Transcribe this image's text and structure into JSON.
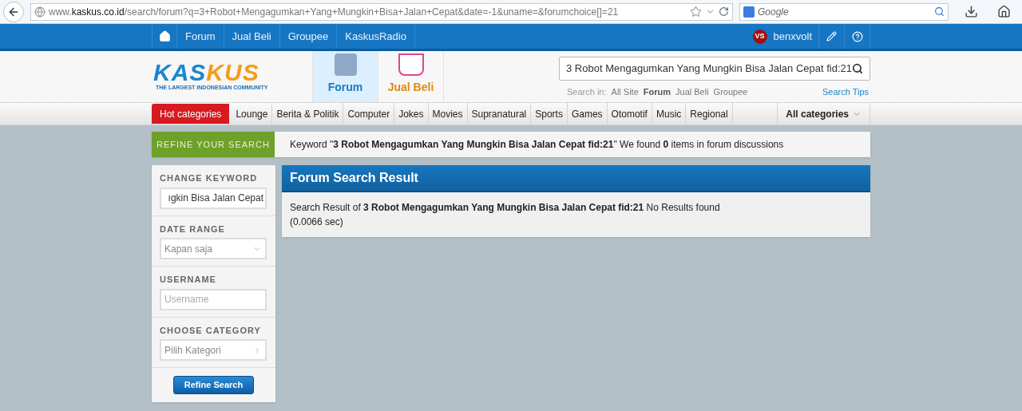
{
  "browser": {
    "url_prefix": "www.",
    "url_domain": "kaskus.co.id",
    "url_path": "/search/forum?q=3+Robot+Mengagumkan+Yang+Mungkin+Bisa+Jalan+Cepat&date=-1&uname=&forumchoice[]=21",
    "search_placeholder": "Google"
  },
  "top_nav": {
    "items": [
      "Forum",
      "Jual Beli",
      "Groupee",
      "KaskusRadio"
    ],
    "username": "benxvolt",
    "avatar_text": "VS"
  },
  "logo": {
    "part1": "KAS",
    "part2": "KUS",
    "tagline": "THE LARGEST INDONESIAN COMMUNITY"
  },
  "header_tabs": [
    {
      "label": "Forum",
      "selected": true
    },
    {
      "label": "Jual Beli",
      "selected": false
    }
  ],
  "search": {
    "value": "3 Robot Mengagumkan Yang Mungkin Bisa Jalan Cepat fid:21",
    "scope_label": "Search in:",
    "scopes": [
      {
        "label": "All Site",
        "selected": false
      },
      {
        "label": "Forum",
        "selected": true
      },
      {
        "label": "Jual Beli",
        "selected": false
      },
      {
        "label": "Groupee",
        "selected": false
      }
    ],
    "tips": "Search Tips"
  },
  "categories": {
    "hot": "Hot categories",
    "items": [
      "Lounge",
      "Berita & Politik",
      "Computer",
      "Jokes",
      "Movies",
      "Supranatural",
      "Sports",
      "Games",
      "Otomotif",
      "Music",
      "Regional"
    ],
    "all": "All categories"
  },
  "refine_tab": "REFINE YOUR SEARCH",
  "keyword_summary": "Keyword \"**3 Robot Mengagumkan Yang Mungkin Bisa Jalan Cepat fid:21**\" We found **0** items in forum discussions",
  "sidebar": [
    {
      "kind": "text",
      "label": "CHANGE KEYWORD",
      "value": "ıgkin Bisa Jalan Cepat"
    },
    {
      "kind": "select",
      "label": "DATE RANGE",
      "value": "Kapan saja"
    },
    {
      "kind": "input",
      "label": "USERNAME",
      "placeholder": "Username"
    },
    {
      "kind": "menu",
      "label": "CHOOSE CATEGORY",
      "value": "Pilih Kategori"
    }
  ],
  "refine_button": "Refine Search",
  "result": {
    "title": "Forum Search Result",
    "text": "Search Result of **3 Robot Mengagumkan Yang Mungkin Bisa Jalan Cepat fid:21** No Results found (0.0066 sec)"
  }
}
